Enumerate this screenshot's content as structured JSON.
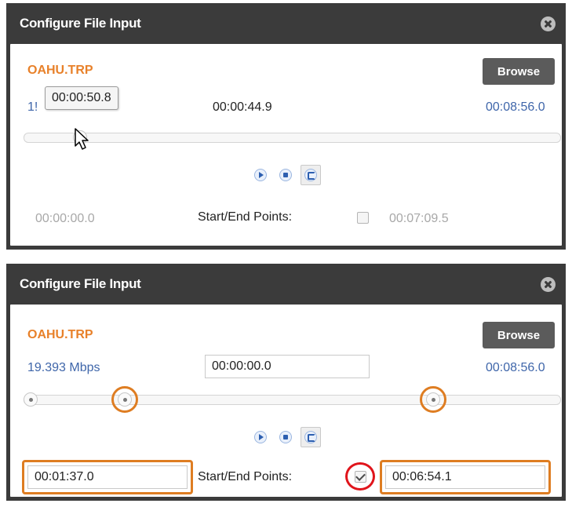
{
  "panel1": {
    "title": "Configure File Input",
    "filename": "OAHU.TRP",
    "browse_label": "Browse",
    "bitrate_partial": "1!",
    "tooltip": "00:00:50.8",
    "current_time": "00:00:44.9",
    "duration": "00:08:56.0",
    "start_time": "00:00:00.0",
    "start_end_label": "Start/End Points:",
    "start_end_checked": false,
    "end_time": "00:07:09.5",
    "playhead_fraction": 0.095
  },
  "panel2": {
    "title": "Configure File Input",
    "filename": "OAHU.TRP",
    "browse_label": "Browse",
    "bitrate": "19.393 Mbps",
    "current_time": "00:00:00.0",
    "duration": "00:08:56.0",
    "start_end_label": "Start/End Points:",
    "start_end_checked": true,
    "start_time": "00:01:37.0",
    "end_time": "00:06:54.1",
    "playhead_fraction": 0.0,
    "start_fraction": 0.181,
    "end_fraction": 0.772
  },
  "colors": {
    "titlebar": "#3b3b3b",
    "filename": "#e8812a",
    "link_blue": "#3f66aa",
    "highlight_orange": "#de7d22",
    "highlight_red": "#e0141b"
  },
  "icons": [
    "close-icon",
    "play-icon",
    "stop-icon",
    "loop-icon",
    "cursor-icon",
    "check-icon"
  ]
}
